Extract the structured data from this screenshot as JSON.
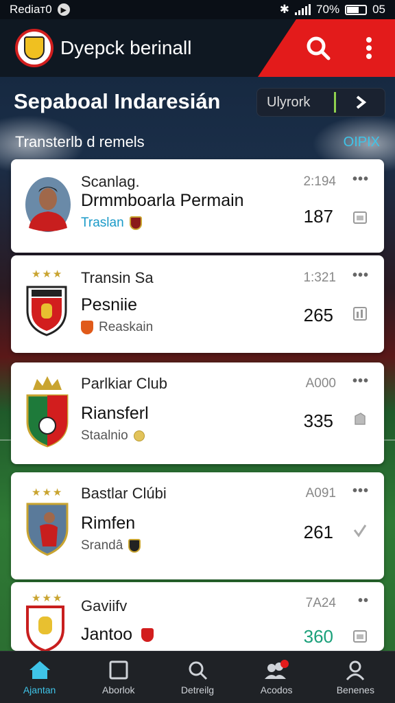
{
  "status_bar": {
    "left_text": "Rediaт0",
    "battery_text": "70%",
    "time_right": "05"
  },
  "app_bar": {
    "title": "Dyepck berinall"
  },
  "section": {
    "title": "Sepaboal Indaresián",
    "view_button_label": "Ulyrork"
  },
  "subheader": {
    "left": "Transterlb d remels",
    "right": "OIPIX"
  },
  "cards": [
    {
      "line1": "Scanlag.",
      "line2": "Drmmboarla Permain",
      "line3": "Traslan",
      "code": "2:194",
      "number": "187"
    },
    {
      "line1": "Transin Sa",
      "line2": "Pesniie",
      "line3": "Reaskain",
      "code": "1:321",
      "number": "265"
    },
    {
      "line1": "Parlkiar Club",
      "line2": "Riansferl",
      "line3": "Staalnio",
      "code": "A000",
      "number": "335"
    },
    {
      "line1": "Bastlar Clúbi",
      "line2": "Rimfen",
      "line3": "Srandâ",
      "code": "A091",
      "number": "261"
    },
    {
      "line1": "Gaviifv",
      "line2": "Jantoo",
      "line3": "",
      "code": "7A24",
      "number": "360"
    }
  ],
  "bottom_nav": [
    {
      "label": "Ajantan",
      "icon": "home-icon"
    },
    {
      "label": "Aborlok",
      "icon": "square-icon"
    },
    {
      "label": "Detreilg",
      "icon": "search-icon"
    },
    {
      "label": "Acodos",
      "icon": "users-icon"
    },
    {
      "label": "Benenes",
      "icon": "profile-icon"
    }
  ],
  "colors": {
    "accent_red": "#e31b1b",
    "accent_blue": "#3fc4e8",
    "highlight_green": "#1aa07a"
  }
}
